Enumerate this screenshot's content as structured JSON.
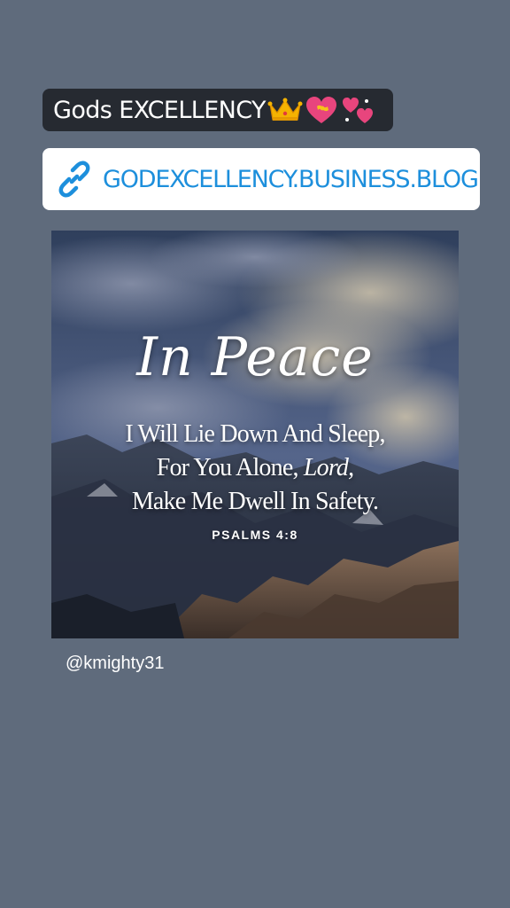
{
  "story": {
    "title_text": "Gods EXCELLENCY",
    "title_emojis": [
      "crown-icon",
      "heart-with-ribbon-icon",
      "revolving-hearts-icon"
    ],
    "link": {
      "icon": "link-icon",
      "url_text": "GODEXCELLENCY.BUSINESS.BLOG"
    },
    "post_image": {
      "script_title": "In Peace",
      "line1": "I Will Lie Down And Sleep,",
      "line2_prefix": "For You Alone, ",
      "line2_emph": "Lord,",
      "line3": "Make Me Dwell In Safety.",
      "reference": "PSALMS 4:8"
    },
    "mention": "@kmighty31"
  },
  "colors": {
    "background": "#5f6b7c",
    "title_pill_bg": "#262a31",
    "link_color": "#1d8fdc"
  }
}
